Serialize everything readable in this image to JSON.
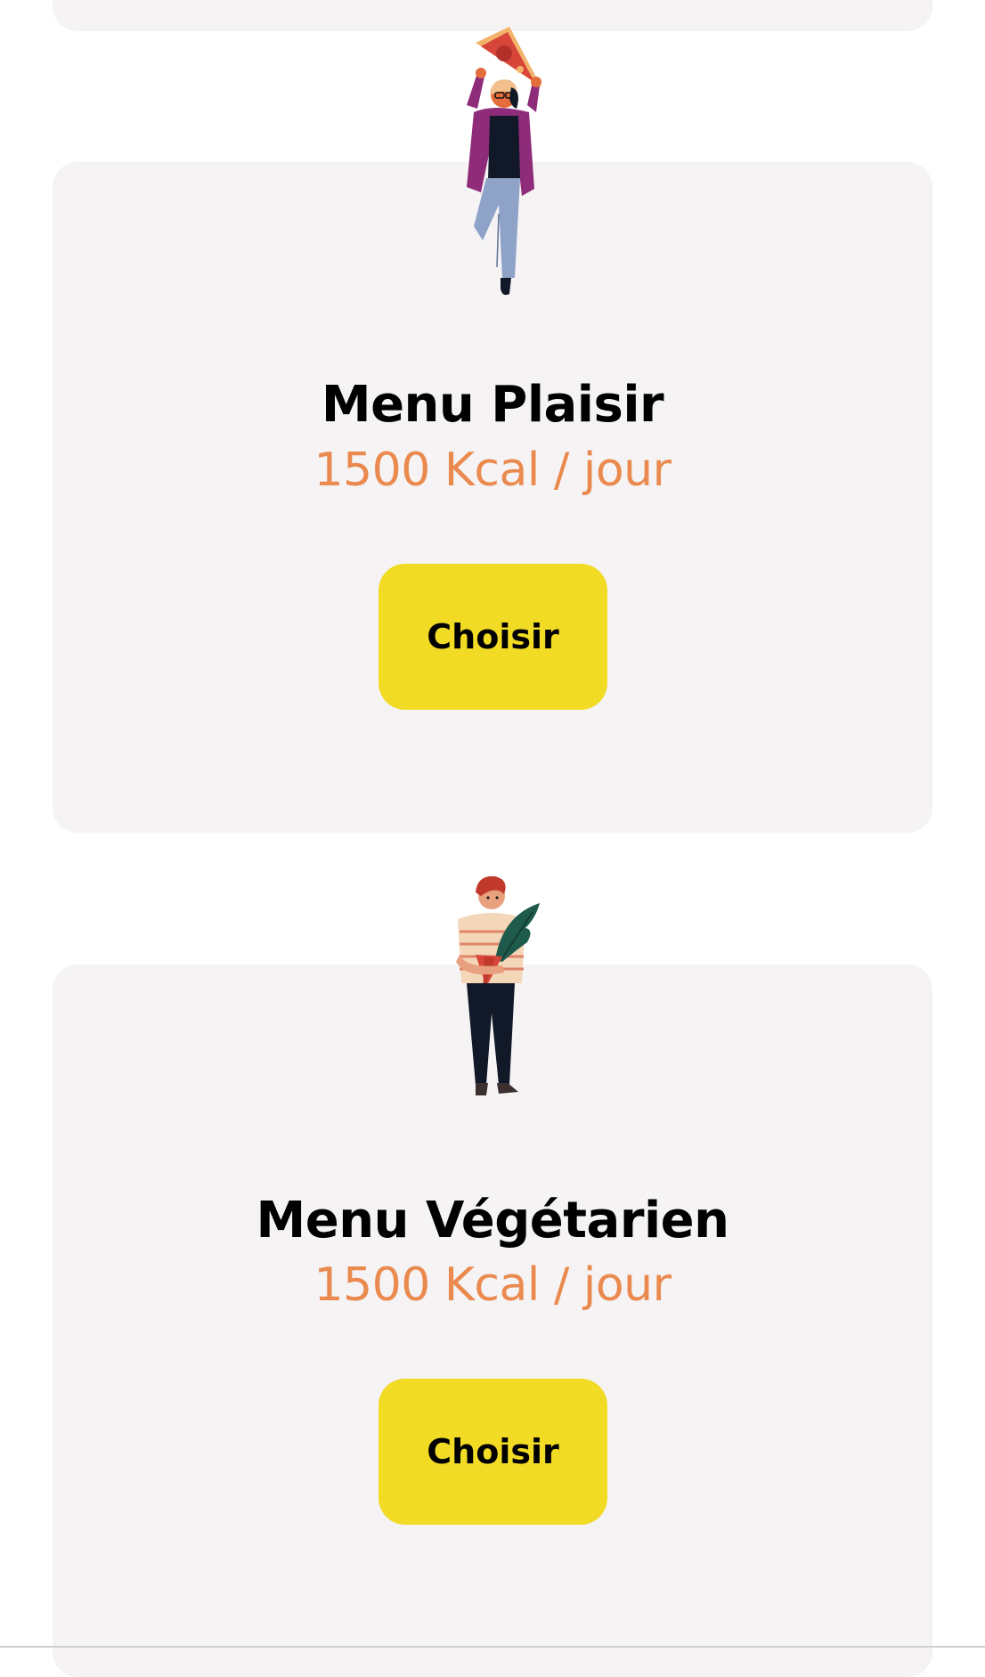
{
  "menus": [
    {
      "title": "Menu Plaisir",
      "kcal": "1500 Kcal / jour",
      "button_label": "Choisir",
      "illustration": "person-holding-pizza-illustration"
    },
    {
      "title": "Menu Végétarien",
      "kcal": "1500 Kcal / jour",
      "button_label": "Choisir",
      "illustration": "person-holding-vegetables-illustration"
    }
  ],
  "colors": {
    "card_background": "#f5f3f4",
    "kcal_text": "#ea8a4f",
    "button_background": "#f1db24",
    "title_text": "#000000"
  }
}
